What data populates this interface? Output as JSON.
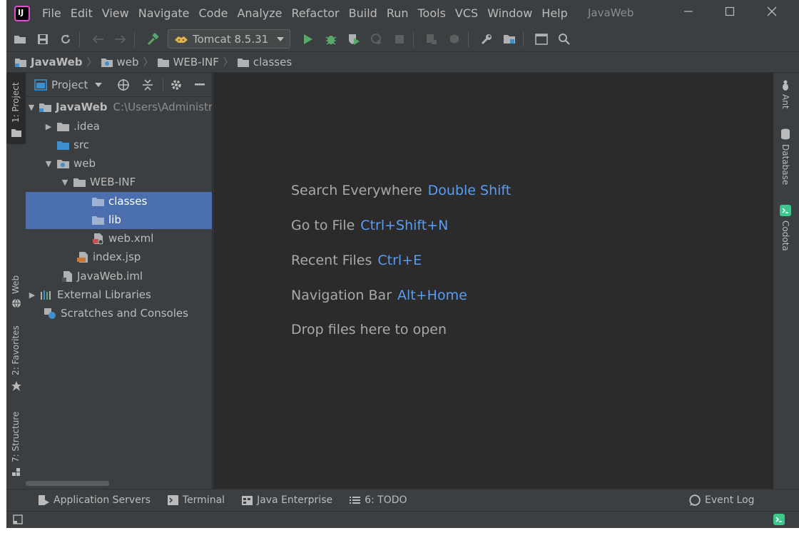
{
  "app": {
    "window_title": "JavaWeb",
    "logo_text": "IJ"
  },
  "menu": [
    "File",
    "Edit",
    "View",
    "Navigate",
    "Code",
    "Analyze",
    "Refactor",
    "Build",
    "Run",
    "Tools",
    "VCS",
    "Window",
    "Help"
  ],
  "toolbar": {
    "run_config": "Tomcat 8.5.31"
  },
  "breadcrumb": [
    "JavaWeb",
    "web",
    "WEB-INF",
    "classes"
  ],
  "left_strip": {
    "project_tab": "1: Project",
    "web_tab": "Web",
    "favorites_tab": "2: Favorites",
    "structure_tab": "7: Structure"
  },
  "project_panel": {
    "title": "Project",
    "tree": [
      {
        "label": "JavaWeb",
        "hint": "C:\\Users\\Administr"
      },
      {
        "label": ".idea"
      },
      {
        "label": "src"
      },
      {
        "label": "web"
      },
      {
        "label": "WEB-INF"
      },
      {
        "label": "classes"
      },
      {
        "label": "lib"
      },
      {
        "label": "web.xml"
      },
      {
        "label": "index.jsp"
      },
      {
        "label": "JavaWeb.iml"
      },
      {
        "label": "External Libraries"
      },
      {
        "label": "Scratches and Consoles"
      }
    ]
  },
  "editor_hints": [
    {
      "label": "Search Everywhere",
      "key": "Double Shift"
    },
    {
      "label": "Go to File",
      "key": "Ctrl+Shift+N"
    },
    {
      "label": "Recent Files",
      "key": "Ctrl+E"
    },
    {
      "label": "Navigation Bar",
      "key": "Alt+Home"
    },
    {
      "label": "Drop files here to open",
      "key": ""
    }
  ],
  "right_strip": {
    "ant": "Ant",
    "database": "Database",
    "codota": "Codota"
  },
  "bottom_tabs": {
    "app_servers": "Application Servers",
    "terminal": "Terminal",
    "java_enterprise": "Java Enterprise",
    "todo": "6: TODO",
    "event_log": "Event Log"
  },
  "colors": {
    "background": "#3c3f41",
    "editor": "#2b2b2b",
    "selection": "#4b6eaf",
    "shortcut": "#589df6",
    "run_green": "#59a869"
  }
}
